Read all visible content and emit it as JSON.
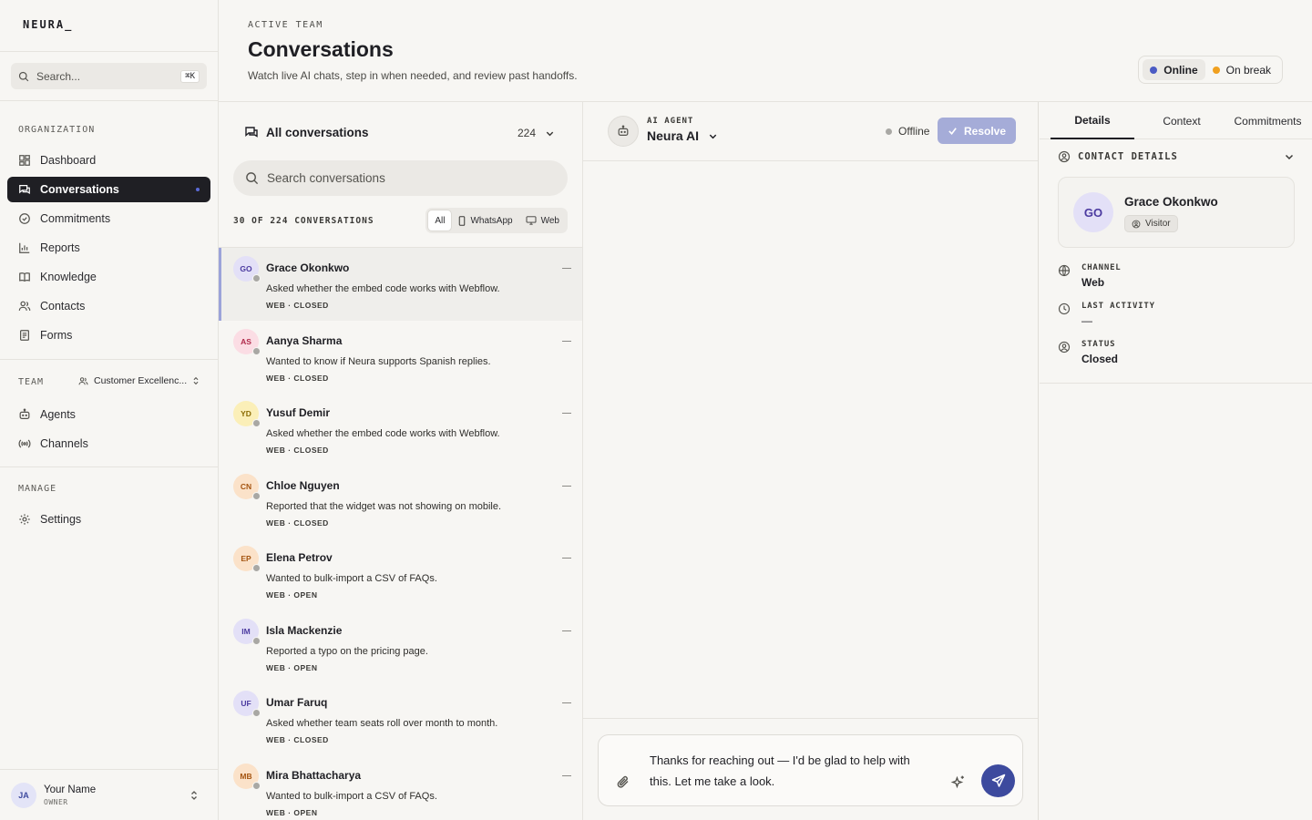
{
  "app": {
    "logo": "NEURA_"
  },
  "sidebar": {
    "search_placeholder": "Search...",
    "search_shortcut": "⌘K",
    "org_label": "ORGANIZATION",
    "org_items": [
      {
        "label": "Dashboard",
        "icon": "dashboard-icon"
      },
      {
        "label": "Conversations",
        "icon": "chat-icon",
        "active": true
      },
      {
        "label": "Commitments",
        "icon": "check-circle-icon"
      },
      {
        "label": "Reports",
        "icon": "bar-chart-icon"
      },
      {
        "label": "Knowledge",
        "icon": "book-icon"
      },
      {
        "label": "Contacts",
        "icon": "users-icon"
      },
      {
        "label": "Forms",
        "icon": "form-icon"
      }
    ],
    "team_label": "TEAM",
    "team_select": "Customer Excellenc...",
    "team_items": [
      {
        "label": "Agents",
        "icon": "robot-icon"
      },
      {
        "label": "Channels",
        "icon": "broadcast-icon"
      }
    ],
    "manage_label": "MANAGE",
    "manage_items": [
      {
        "label": "Settings",
        "icon": "gear-icon"
      }
    ],
    "user": {
      "initials": "JA",
      "name": "Your Name",
      "role": "OWNER"
    }
  },
  "header": {
    "eyebrow": "ACTIVE TEAM",
    "title": "Conversations",
    "subtitle": "Watch live AI chats, step in when needed, and review past handoffs.",
    "status_options": [
      {
        "label": "Online",
        "color": "#4b5bc4",
        "selected": true
      },
      {
        "label": "On break",
        "color": "#f0a020",
        "selected": false
      }
    ]
  },
  "list": {
    "title": "All conversations",
    "count": "224",
    "search_placeholder": "Search conversations",
    "filter_label": "30 OF 224 CONVERSATIONS",
    "filters": [
      {
        "label": "All",
        "selected": true
      },
      {
        "label": "WhatsApp",
        "icon": "phone-icon"
      },
      {
        "label": "Web",
        "icon": "monitor-icon"
      }
    ],
    "items": [
      {
        "initials": "GO",
        "name": "Grace Okonkwo",
        "preview": "Asked whether the embed code works with Webflow.",
        "meta": "WEB · CLOSED",
        "avatar_bg": "#e3e0f7",
        "avatar_fg": "#4b3aa0",
        "selected": true
      },
      {
        "initials": "AS",
        "name": "Aanya Sharma",
        "preview": "Wanted to know if Neura supports Spanish replies.",
        "meta": "WEB · CLOSED",
        "avatar_bg": "#fbdde4",
        "avatar_fg": "#b02a4a"
      },
      {
        "initials": "YD",
        "name": "Yusuf Demir",
        "preview": "Asked whether the embed code works with Webflow.",
        "meta": "WEB · CLOSED",
        "avatar_bg": "#fbefb8",
        "avatar_fg": "#8a6a00"
      },
      {
        "initials": "CN",
        "name": "Chloe Nguyen",
        "preview": "Reported that the widget was not showing on mobile.",
        "meta": "WEB · CLOSED",
        "avatar_bg": "#fbe2c9",
        "avatar_fg": "#a45410"
      },
      {
        "initials": "EP",
        "name": "Elena Petrov",
        "preview": "Wanted to bulk-import a CSV of FAQs.",
        "meta": "WEB · OPEN",
        "avatar_bg": "#fbe2c9",
        "avatar_fg": "#a45410"
      },
      {
        "initials": "IM",
        "name": "Isla Mackenzie",
        "preview": "Reported a typo on the pricing page.",
        "meta": "WEB · OPEN",
        "avatar_bg": "#e3e0f7",
        "avatar_fg": "#4b3aa0"
      },
      {
        "initials": "UF",
        "name": "Umar Faruq",
        "preview": "Asked whether team seats roll over month to month.",
        "meta": "WEB · CLOSED",
        "avatar_bg": "#e3e0f7",
        "avatar_fg": "#4b3aa0"
      },
      {
        "initials": "MB",
        "name": "Mira Bhattacharya",
        "preview": "Wanted to bulk-import a CSV of FAQs.",
        "meta": "WEB · OPEN",
        "avatar_bg": "#fbe2c9",
        "avatar_fg": "#a45410"
      }
    ]
  },
  "chat": {
    "agent_label": "AI AGENT",
    "agent_name": "Neura AI",
    "presence": "Offline",
    "resolve_label": "Resolve",
    "draft": "Thanks for reaching out — I'd be glad to help with this. Let me take a look."
  },
  "details": {
    "tabs": [
      "Details",
      "Context",
      "Commitments"
    ],
    "section_title": "CONTACT DETAILS",
    "contact": {
      "initials": "GO",
      "name": "Grace Okonkwo",
      "badge": "Visitor"
    },
    "fields": [
      {
        "label": "CHANNEL",
        "value": "Web",
        "icon": "globe-icon"
      },
      {
        "label": "LAST ACTIVITY",
        "value": "—",
        "icon": "clock-icon"
      },
      {
        "label": "STATUS",
        "value": "Closed",
        "icon": "user-circle-icon"
      }
    ]
  }
}
